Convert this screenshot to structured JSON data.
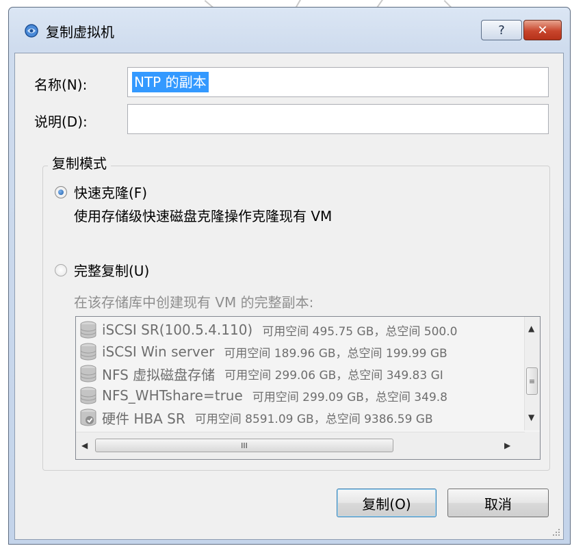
{
  "window": {
    "title": "复制虚拟机",
    "help_label": "?",
    "close_label": "✕"
  },
  "form": {
    "name_label": "名称(N):",
    "name_value": "NTP 的副本",
    "description_label": "说明(D):",
    "description_value": ""
  },
  "copy_mode": {
    "group_title": "复制模式",
    "fast_clone": {
      "label": "快速克隆(F)",
      "description": "使用存储级快速磁盘克隆操作克隆现有 VM",
      "selected": true
    },
    "full_copy": {
      "label": "完整复制(U)",
      "description": "在该存储库中创建现有 VM 的完整副本:",
      "selected": false
    }
  },
  "storage_list": {
    "items": [
      {
        "name": "iSCSI SR(100.5.4.110)",
        "info": "可用空间 495.75 GB，总空间 500.0",
        "icon": "disk-stack-icon"
      },
      {
        "name": "iSCSI Win server",
        "info": "可用空间 189.96 GB，总空间 199.99 GB",
        "icon": "disk-stack-icon"
      },
      {
        "name": "NFS 虚拟磁盘存储",
        "info": "可用空间 299.06 GB，总空间 349.83 GI",
        "icon": "disk-stack-icon"
      },
      {
        "name": "NFS_WHTshare=true",
        "info": "可用空间 299.09 GB，总空间 349.8",
        "icon": "disk-stack-icon"
      },
      {
        "name": "硬件 HBA SR",
        "info": "可用空间 8591.09 GB，总空间 9386.59 GB",
        "icon": "disk-check-icon"
      }
    ],
    "hscroll_thumb_label": "III",
    "vscroll_thumb_label": "≡"
  },
  "buttons": {
    "copy_label": "复制(O)",
    "cancel_label": "取消"
  },
  "colors": {
    "selection": "#3399ff",
    "title_gradient_top": "#dbe6f4",
    "close_button": "#c8452c",
    "disabled_text": "#8e8e8e"
  }
}
